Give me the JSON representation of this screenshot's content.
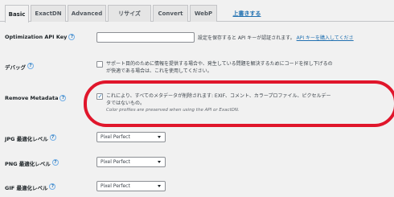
{
  "tabs": [
    {
      "label": "Basic"
    },
    {
      "label": "ExactDN"
    },
    {
      "label": "Advanced"
    },
    {
      "label": "リサイズ"
    },
    {
      "label": "Convert"
    },
    {
      "label": "WebP"
    },
    {
      "label": "上書きする"
    }
  ],
  "optimization_api_key": {
    "label": "Optimization API Key",
    "help_icon": "question-mark",
    "description_prefix": "設定を保存すると API キーが認証されます。",
    "link_text": "API キーを購入してくださ"
  },
  "debug": {
    "label": "デバッグ",
    "checked": false,
    "description_line1": "サポート目的のために情報を提供する場合や、発生している問題を解決するためにコードを探し下げるの",
    "description_line2": "が快適である場合は、これを使用してください。"
  },
  "remove_metadata": {
    "label": "Remove Metadata",
    "checked": true,
    "description_line1": "これにより、すべてのメタデータが削除されます: EXIF、コメント、カラープロファイル、ピクセルデー",
    "description_line2": "タではないもの。",
    "note": "Color profiles are preserved when using the API or ExactDN.",
    "highlight_color": "#e0162b"
  },
  "jpg_level": {
    "label": "JPG 最適化レベル",
    "value": "Pixel Perfect"
  },
  "png_level": {
    "label": "PNG 最適化レベル",
    "value": "Pixel Perfect"
  },
  "gif_level": {
    "label": "GIF 最適化レベル",
    "value": "Pixel Perfect"
  }
}
